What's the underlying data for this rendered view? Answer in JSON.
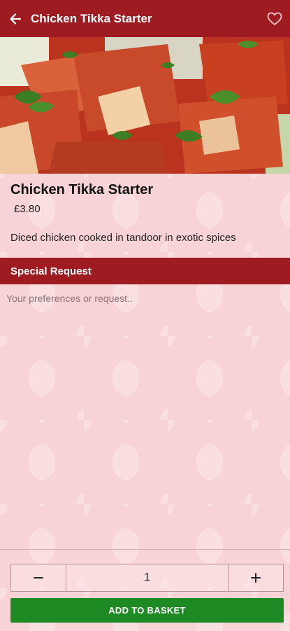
{
  "appbar": {
    "title": "Chicken Tikka Starter",
    "back_icon": "arrow-left-icon",
    "favorite_icon": "heart-outline-icon"
  },
  "item": {
    "name": "Chicken Tikka Starter",
    "price": "£3.80",
    "description": "Diced chicken cooked in tandoor in exotic spices"
  },
  "special_request": {
    "heading": "Special Request",
    "placeholder": "Your preferences or request.."
  },
  "quantity": {
    "value": "1",
    "minus_icon": "minus-icon",
    "plus_icon": "plus-icon"
  },
  "add_button": {
    "label": "ADD TO BASKET"
  },
  "colors": {
    "primary": "#9e1b22",
    "accent": "#1e8a23",
    "background": "#f8d3d6"
  }
}
